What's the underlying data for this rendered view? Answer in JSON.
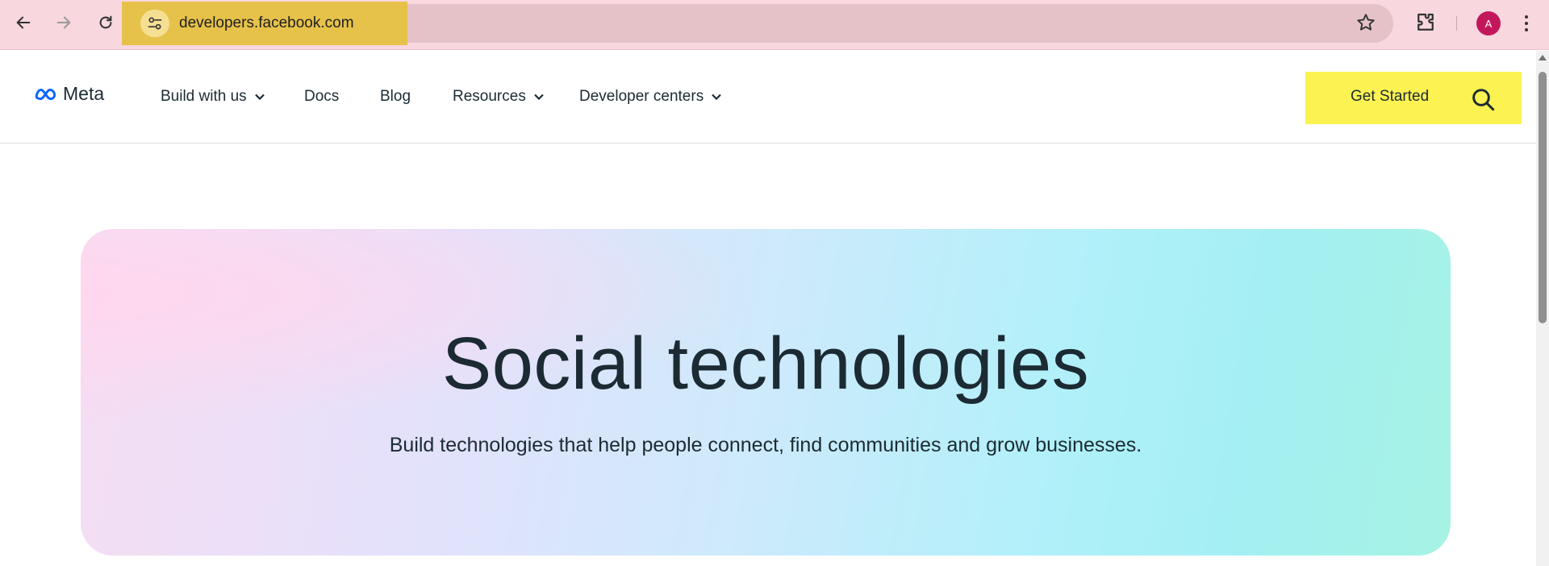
{
  "browser": {
    "url": "developers.facebook.com",
    "profile_initial": "A",
    "icons": {
      "back": "back-arrow-icon",
      "forward": "forward-arrow-icon",
      "reload": "reload-icon",
      "site_info": "site-settings-icon",
      "bookmark": "star-icon",
      "extensions": "puzzle-icon",
      "menu": "kebab-menu-icon"
    }
  },
  "header": {
    "logo_text": "Meta",
    "nav": [
      {
        "label": "Build with us",
        "has_dropdown": true
      },
      {
        "label": "Docs",
        "has_dropdown": false
      },
      {
        "label": "Blog",
        "has_dropdown": false
      },
      {
        "label": "Resources",
        "has_dropdown": true
      },
      {
        "label": "Developer centers",
        "has_dropdown": true
      }
    ],
    "cta_label": "Get Started",
    "cta_color": "#fcf251"
  },
  "hero": {
    "title": "Social technologies",
    "subtitle": "Build technologies that help people connect, find communities and grow businesses."
  },
  "colors": {
    "chrome_bg": "#f8d7df",
    "highlight": "#e6c24a",
    "text": "#1c2b33",
    "meta_blue": "#0866ff"
  }
}
